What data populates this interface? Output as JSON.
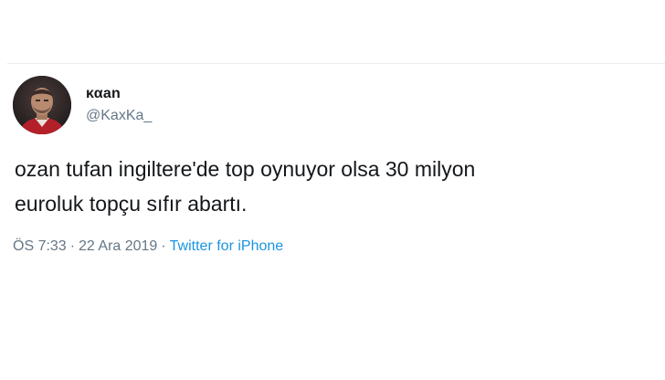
{
  "tweet": {
    "author": {
      "display_name": "καan",
      "handle": "@KaxKa_"
    },
    "text": "ozan tufan ingiltere'de top oynuyor olsa 30 milyon\neuroluk topçu sıfır abartı.",
    "time": "ÖS 7:33",
    "date": "22 Ara 2019",
    "separator": "·",
    "source": "Twitter for iPhone"
  },
  "colors": {
    "text": "#14171a",
    "secondary": "#657786",
    "link": "#1b95e0",
    "divider": "#e6ecf0"
  },
  "icons": {
    "avatar": "profile-photo"
  }
}
